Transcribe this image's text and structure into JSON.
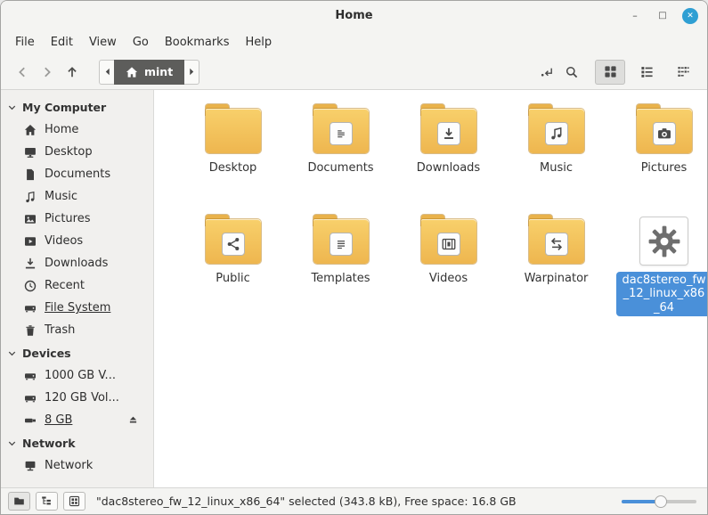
{
  "colors": {
    "accent": "#4a90d9",
    "folder": "#f2c04e",
    "close_button": "#2f9fd3"
  },
  "window": {
    "title": "Home",
    "controls": {
      "minimize": "–",
      "maximize": "□",
      "close": "✕"
    }
  },
  "menubar": [
    {
      "label": "File"
    },
    {
      "label": "Edit"
    },
    {
      "label": "View"
    },
    {
      "label": "Go"
    },
    {
      "label": "Bookmarks"
    },
    {
      "label": "Help"
    }
  ],
  "toolbar": {
    "breadcrumb_label": "mint"
  },
  "sidebar": {
    "sections": [
      {
        "label": "My Computer",
        "items": [
          {
            "label": "Home",
            "icon": "home-icon"
          },
          {
            "label": "Desktop",
            "icon": "desktop-icon"
          },
          {
            "label": "Documents",
            "icon": "documents-icon"
          },
          {
            "label": "Music",
            "icon": "music-icon"
          },
          {
            "label": "Pictures",
            "icon": "pictures-icon"
          },
          {
            "label": "Videos",
            "icon": "videos-icon"
          },
          {
            "label": "Downloads",
            "icon": "downloads-icon"
          },
          {
            "label": "Recent",
            "icon": "recent-icon"
          },
          {
            "label": "File System",
            "icon": "filesystem-icon",
            "underlined": true
          },
          {
            "label": "Trash",
            "icon": "trash-icon"
          }
        ]
      },
      {
        "label": "Devices",
        "items": [
          {
            "label": "1000 GB V...",
            "icon": "drive-icon"
          },
          {
            "label": "120 GB Vol...",
            "icon": "drive-icon"
          },
          {
            "label": "8 GB",
            "icon": "usb-icon",
            "underlined": true,
            "eject": true
          }
        ]
      },
      {
        "label": "Network",
        "items": [
          {
            "label": "Network",
            "icon": "network-icon"
          }
        ]
      }
    ]
  },
  "files": {
    "items": [
      {
        "label": "Desktop",
        "type": "folder",
        "emblem": null
      },
      {
        "label": "Documents",
        "type": "folder",
        "emblem": "document-emblem"
      },
      {
        "label": "Downloads",
        "type": "folder",
        "emblem": "download-emblem"
      },
      {
        "label": "Music",
        "type": "folder",
        "emblem": "music-emblem"
      },
      {
        "label": "Pictures",
        "type": "folder",
        "emblem": "camera-emblem"
      },
      {
        "label": "Public",
        "type": "folder",
        "emblem": "share-emblem"
      },
      {
        "label": "Templates",
        "type": "folder",
        "emblem": "template-emblem"
      },
      {
        "label": "Videos",
        "type": "folder",
        "emblem": "video-emblem"
      },
      {
        "label": "Warpinator",
        "type": "folder",
        "emblem": "warp-emblem"
      },
      {
        "label": "dac8stereo_fw_12_linux_x86_64",
        "type": "executable",
        "icon": "gear-icon",
        "selected": true
      }
    ]
  },
  "statusbar": {
    "status_text": "\"dac8stereo_fw_12_linux_x86_64\" selected (343.8 kB), Free space: 16.8 GB",
    "zoom_fraction": 0.52
  }
}
